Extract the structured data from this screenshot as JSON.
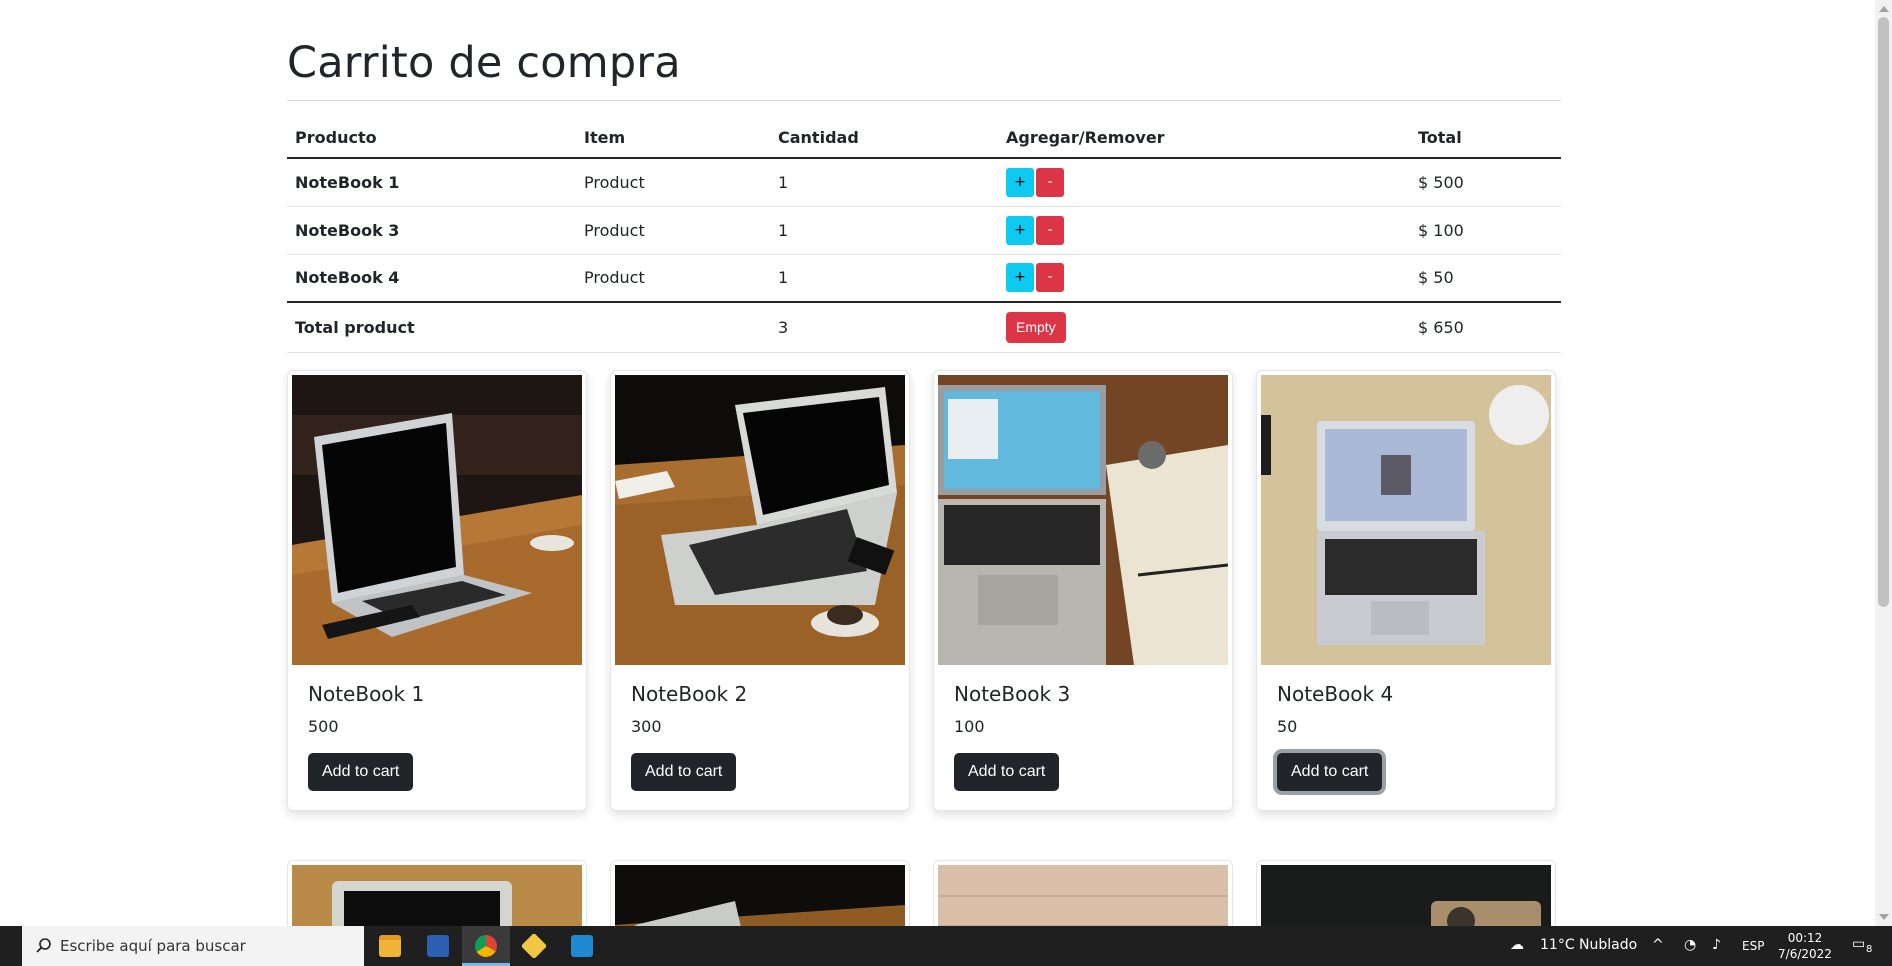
{
  "page": {
    "title": "Carrito de compra"
  },
  "cart": {
    "headers": [
      "Producto",
      "Item",
      "Cantidad",
      "Agregar/Remover",
      "Total"
    ],
    "rows": [
      {
        "product": "NoteBook 1",
        "item": "Product",
        "qty": "1",
        "total": "$ 500"
      },
      {
        "product": "NoteBook 3",
        "item": "Product",
        "qty": "1",
        "total": "$ 100"
      },
      {
        "product": "NoteBook 4",
        "item": "Product",
        "qty": "1",
        "total": "$ 50"
      }
    ],
    "plus_label": "+",
    "minus_label": "-",
    "summary": {
      "label": "Total product",
      "qty": "3",
      "empty_label": "Empty",
      "total": "$ 650"
    }
  },
  "products": [
    {
      "name": "NoteBook 1",
      "price": "500",
      "button": "Add to cart"
    },
    {
      "name": "NoteBook 2",
      "price": "300",
      "button": "Add to cart"
    },
    {
      "name": "NoteBook 3",
      "price": "100",
      "button": "Add to cart"
    },
    {
      "name": "NoteBook 4",
      "price": "50",
      "button": "Add to cart"
    }
  ],
  "taskbar": {
    "search_placeholder": "Escribe aquí para buscar",
    "weather": "11°C  Nublado",
    "language": "ESP",
    "time": "00:12",
    "date": "7/6/2022",
    "notifications": "8"
  },
  "colors": {
    "info": "#0dcaf0",
    "danger": "#dc3545",
    "dark": "#212529"
  }
}
